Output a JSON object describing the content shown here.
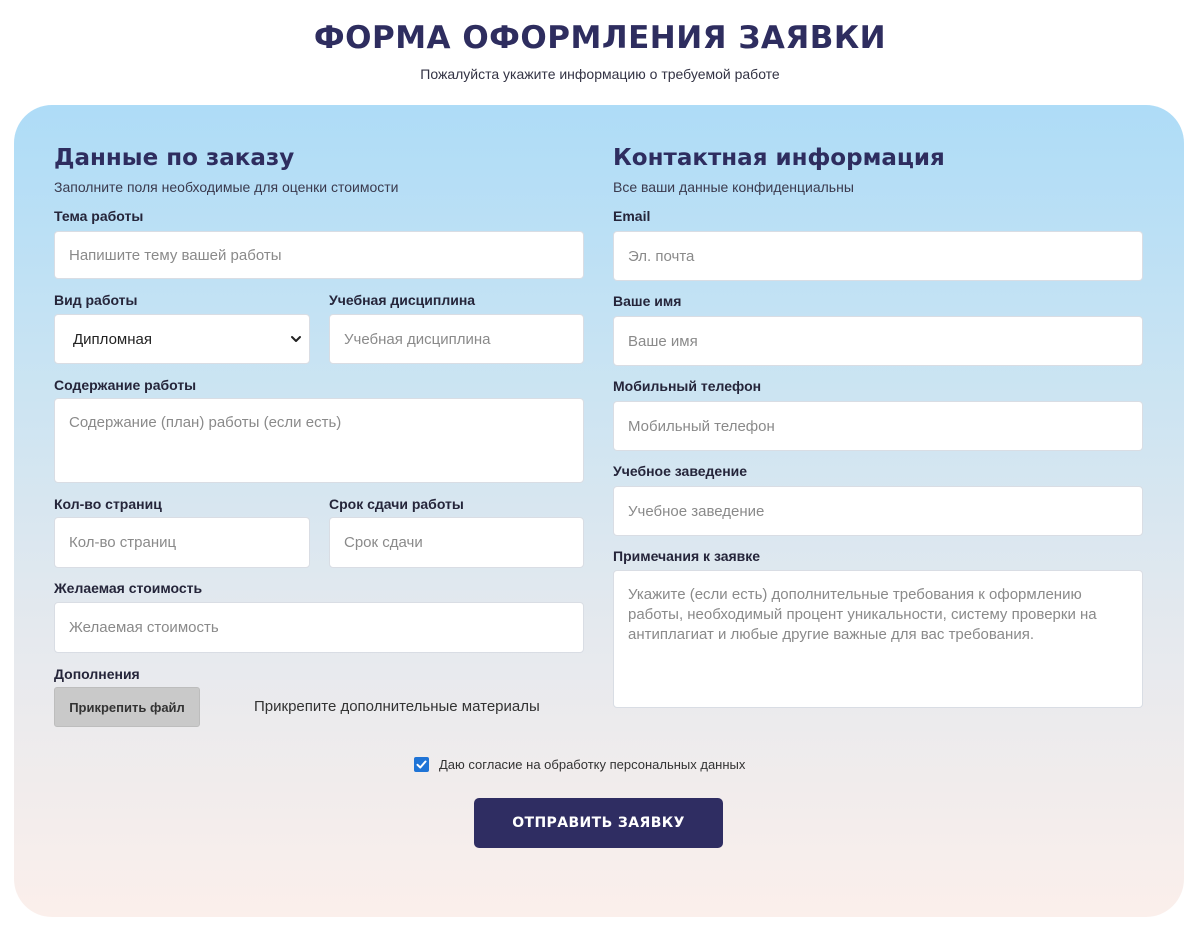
{
  "header": {
    "title": "ФОРМА ОФОРМЛЕНИЯ ЗАЯВКИ",
    "subtitle": "Пожалуйста укажите информацию о требуемой работе"
  },
  "order": {
    "title": "Данные по заказу",
    "subtitle": "Заполните поля необходимые для оценки стоимости",
    "topic": {
      "label": "Тема работы",
      "placeholder": "Напишите тему вашей работы"
    },
    "work_type": {
      "label": "Вид работы",
      "selected": "Дипломная",
      "icon": "chevron-down-icon"
    },
    "discipline": {
      "label": "Учебная дисциплина",
      "placeholder": "Учебная дисциплина"
    },
    "content": {
      "label": "Содержание работы",
      "placeholder": "Содержание (план) работы (если есть)"
    },
    "pages": {
      "label": "Кол-во страниц",
      "placeholder": "Кол-во страниц"
    },
    "deadline": {
      "label": "Срок сдачи работы",
      "placeholder": "Срок сдачи"
    },
    "price": {
      "label": "Желаемая стоимость",
      "placeholder": "Желаемая стоимость"
    },
    "attachments": {
      "label": "Дополнения",
      "button_label": "Прикрепить файл",
      "hint": "Прикрепите дополнительные материалы"
    }
  },
  "contact": {
    "title": "Контактная информация",
    "subtitle": "Все ваши данные конфиденциальны",
    "email": {
      "label": "Email",
      "placeholder": "Эл. почта"
    },
    "name": {
      "label": "Ваше имя",
      "placeholder": "Ваше имя"
    },
    "phone": {
      "label": "Мобильный телефон",
      "placeholder": "Мобильный телефон"
    },
    "institution": {
      "label": "Учебное заведение",
      "placeholder": "Учебное заведение"
    },
    "notes": {
      "label": "Примечания к заявке",
      "placeholder": "Укажите (если есть) дополнительные требования к оформлению работы, необходимый процент уникальности, систему проверки на антиплагиат и любые другие важные для вас требования."
    }
  },
  "consent": {
    "text": "Даю согласие на обработку персональных данных",
    "checked": true
  },
  "submit": {
    "label": "ОТПРАВИТЬ ЗАЯВКУ"
  },
  "colors": {
    "title": "#2e2d5f",
    "button": "#2f2d62",
    "checkbox": "#1f74d6",
    "card_top": "#aedcf7",
    "card_bottom": "#fbefeb"
  }
}
